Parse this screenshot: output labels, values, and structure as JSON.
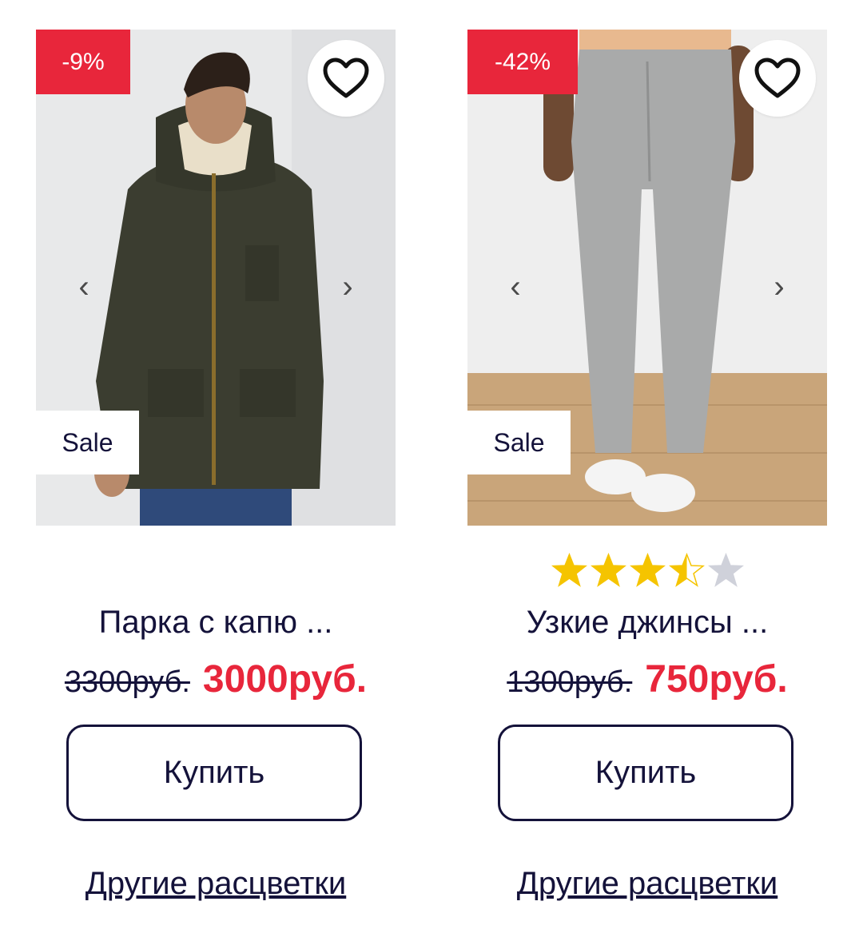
{
  "products": [
    {
      "discount": "-9%",
      "badge": "Sale",
      "name": "Парка с капю ...",
      "old_price": "3300руб.",
      "new_price": "3000руб.",
      "buy_label": "Купить",
      "colors_link": "Другие расцветки",
      "prev_arrow": "‹",
      "next_arrow": "›",
      "rating": null
    },
    {
      "discount": "-42%",
      "badge": "Sale",
      "name": "Узкие джинсы ...",
      "old_price": "1300руб.",
      "new_price": "750руб.",
      "buy_label": "Купить",
      "colors_link": "Другие расцветки",
      "prev_arrow": "‹",
      "next_arrow": "›",
      "rating": 3.5,
      "rating_max": 5
    }
  ],
  "colors": {
    "accent_red": "#e8263b",
    "text_navy": "#14123a",
    "star_gold": "#f5c400",
    "star_empty": "#cfd1da"
  },
  "icons": [
    "heart-outline-icon",
    "chevron-left-icon",
    "chevron-right-icon",
    "star-icon"
  ]
}
